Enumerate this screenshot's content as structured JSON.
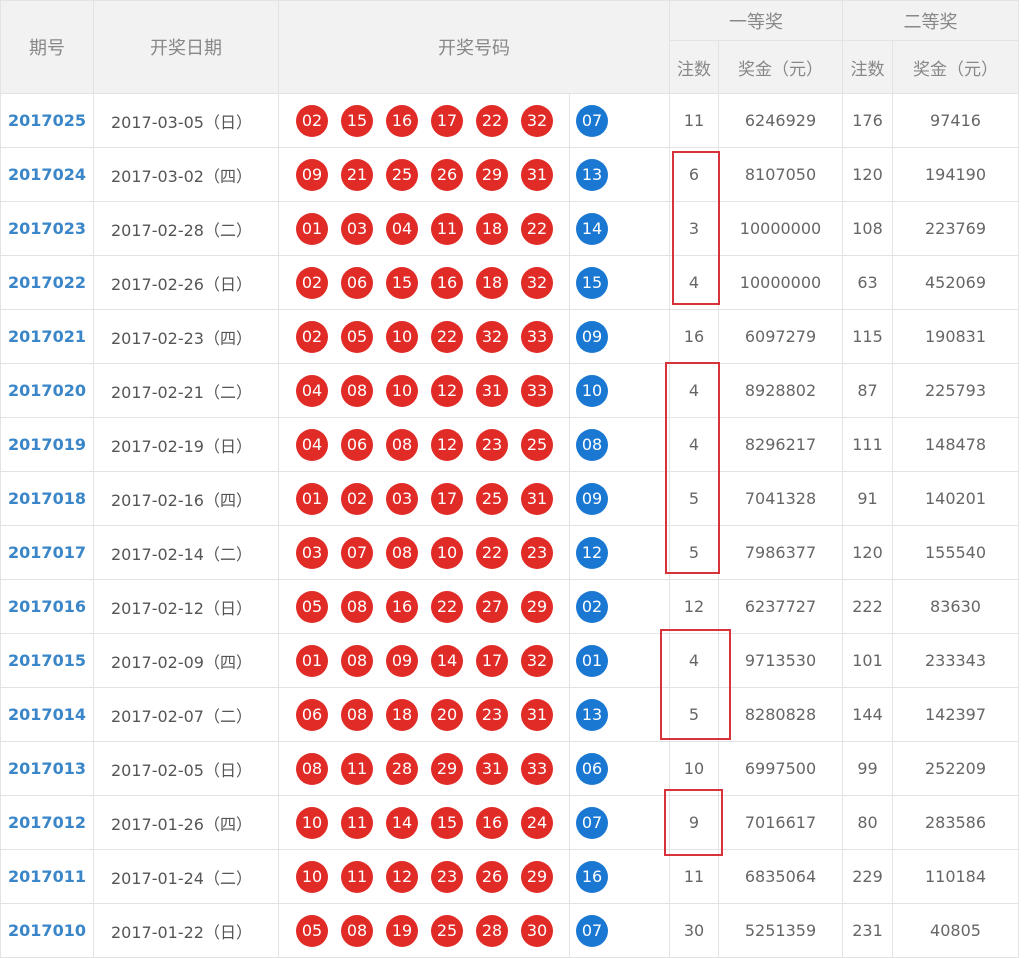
{
  "headers": {
    "issue": "期号",
    "date": "开奖日期",
    "numbers": "开奖号码",
    "first_prize": "一等奖",
    "second_prize": "二等奖",
    "count": "注数",
    "amount": "奖金（元）"
  },
  "rows": [
    {
      "issue": "2017025",
      "date": "2017-03-05（日）",
      "red": [
        "02",
        "15",
        "16",
        "17",
        "22",
        "32"
      ],
      "blue": "07",
      "n1": "11",
      "p1": "6246929",
      "n2": "176",
      "p2": "97416"
    },
    {
      "issue": "2017024",
      "date": "2017-03-02（四）",
      "red": [
        "09",
        "21",
        "25",
        "26",
        "29",
        "31"
      ],
      "blue": "13",
      "n1": "6",
      "p1": "8107050",
      "n2": "120",
      "p2": "194190"
    },
    {
      "issue": "2017023",
      "date": "2017-02-28（二）",
      "red": [
        "01",
        "03",
        "04",
        "11",
        "18",
        "22"
      ],
      "blue": "14",
      "n1": "3",
      "p1": "10000000",
      "n2": "108",
      "p2": "223769"
    },
    {
      "issue": "2017022",
      "date": "2017-02-26（日）",
      "red": [
        "02",
        "06",
        "15",
        "16",
        "18",
        "32"
      ],
      "blue": "15",
      "n1": "4",
      "p1": "10000000",
      "n2": "63",
      "p2": "452069"
    },
    {
      "issue": "2017021",
      "date": "2017-02-23（四）",
      "red": [
        "02",
        "05",
        "10",
        "22",
        "32",
        "33"
      ],
      "blue": "09",
      "n1": "16",
      "p1": "6097279",
      "n2": "115",
      "p2": "190831"
    },
    {
      "issue": "2017020",
      "date": "2017-02-21（二）",
      "red": [
        "04",
        "08",
        "10",
        "12",
        "31",
        "33"
      ],
      "blue": "10",
      "n1": "4",
      "p1": "8928802",
      "n2": "87",
      "p2": "225793"
    },
    {
      "issue": "2017019",
      "date": "2017-02-19（日）",
      "red": [
        "04",
        "06",
        "08",
        "12",
        "23",
        "25"
      ],
      "blue": "08",
      "n1": "4",
      "p1": "8296217",
      "n2": "111",
      "p2": "148478"
    },
    {
      "issue": "2017018",
      "date": "2017-02-16（四）",
      "red": [
        "01",
        "02",
        "03",
        "17",
        "25",
        "31"
      ],
      "blue": "09",
      "n1": "5",
      "p1": "7041328",
      "n2": "91",
      "p2": "140201"
    },
    {
      "issue": "2017017",
      "date": "2017-02-14（二）",
      "red": [
        "03",
        "07",
        "08",
        "10",
        "22",
        "23"
      ],
      "blue": "12",
      "n1": "5",
      "p1": "7986377",
      "n2": "120",
      "p2": "155540"
    },
    {
      "issue": "2017016",
      "date": "2017-02-12（日）",
      "red": [
        "05",
        "08",
        "16",
        "22",
        "27",
        "29"
      ],
      "blue": "02",
      "n1": "12",
      "p1": "6237727",
      "n2": "222",
      "p2": "83630"
    },
    {
      "issue": "2017015",
      "date": "2017-02-09（四）",
      "red": [
        "01",
        "08",
        "09",
        "14",
        "17",
        "32"
      ],
      "blue": "01",
      "n1": "4",
      "p1": "9713530",
      "n2": "101",
      "p2": "233343"
    },
    {
      "issue": "2017014",
      "date": "2017-02-07（二）",
      "red": [
        "06",
        "08",
        "18",
        "20",
        "23",
        "31"
      ],
      "blue": "13",
      "n1": "5",
      "p1": "8280828",
      "n2": "144",
      "p2": "142397"
    },
    {
      "issue": "2017013",
      "date": "2017-02-05（日）",
      "red": [
        "08",
        "11",
        "28",
        "29",
        "31",
        "33"
      ],
      "blue": "06",
      "n1": "10",
      "p1": "6997500",
      "n2": "99",
      "p2": "252209"
    },
    {
      "issue": "2017012",
      "date": "2017-01-26（四）",
      "red": [
        "10",
        "11",
        "14",
        "15",
        "16",
        "24"
      ],
      "blue": "07",
      "n1": "9",
      "p1": "7016617",
      "n2": "80",
      "p2": "283586"
    },
    {
      "issue": "2017011",
      "date": "2017-01-24（二）",
      "red": [
        "10",
        "11",
        "12",
        "23",
        "26",
        "29"
      ],
      "blue": "16",
      "n1": "11",
      "p1": "6835064",
      "n2": "229",
      "p2": "110184"
    },
    {
      "issue": "2017010",
      "date": "2017-01-22（日）",
      "red": [
        "05",
        "08",
        "19",
        "25",
        "28",
        "30"
      ],
      "blue": "07",
      "n1": "30",
      "p1": "5251359",
      "n2": "231",
      "p2": "40805"
    }
  ],
  "colors": {
    "red_ball": "#e02b27",
    "blue_ball": "#1a78d3",
    "issue_link": "#3a86c8",
    "highlight_box": "#d8323a"
  }
}
